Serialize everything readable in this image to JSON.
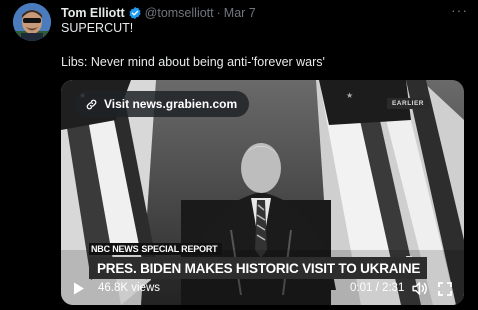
{
  "tweet": {
    "author_name": "Tom Elliott",
    "handle": "@tomselliott",
    "separator": "·",
    "date": "Mar 7",
    "more_label": "···",
    "text_line1": "SUPERCUT!",
    "text_line2": "Libs: Never mind about being anti-'forever wars'"
  },
  "media": {
    "visit_link": "Visit news.grabien.com",
    "earlier_badge": "EARLIER",
    "brand": "NBC NEWS",
    "special_report": "SPECIAL REPORT",
    "headline": "PRES. BIDEN MAKES HISTORIC VISIT TO UKRAINE",
    "views": "46.8K views",
    "time": "0:01 / 2:31"
  },
  "icons": [
    "verified-badge-icon",
    "link-icon",
    "play-icon",
    "volume-icon",
    "fullscreen-icon"
  ],
  "colors": {
    "verified": "#1d9bf0",
    "muted_text": "#71767b",
    "background": "#000000"
  }
}
